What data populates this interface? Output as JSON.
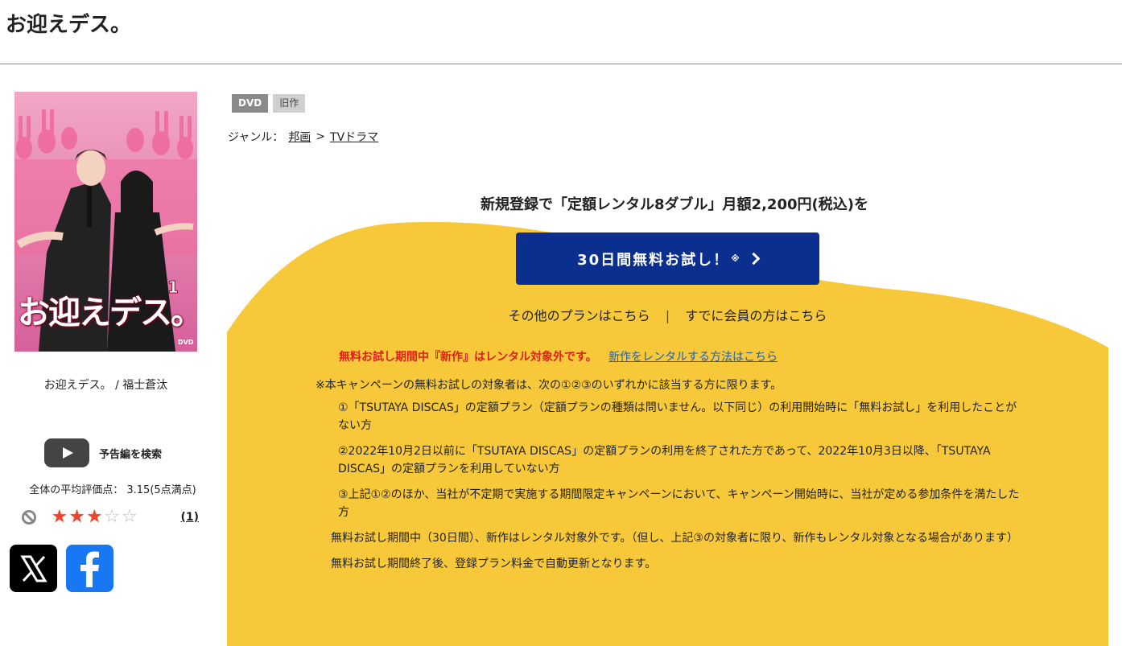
{
  "page": {
    "title": "お迎えデス。"
  },
  "poster": {
    "title_text": "お迎えデス。",
    "volume": "1",
    "dvd_mark": "DVD"
  },
  "work": {
    "caption": "お迎えデス。 / 福士蒼汰"
  },
  "trailer": {
    "label": "予告編を検索"
  },
  "rating": {
    "average_label": "全体の平均評価点： 3.15(5点満点)",
    "stars_value": 3,
    "stars_max": 5,
    "review_count": "(1)"
  },
  "badges": [
    "DVD",
    "旧作"
  ],
  "genre": {
    "label": "ジャンル：",
    "items": [
      "邦画",
      "TVドラマ"
    ],
    "separator": ">"
  },
  "campaign": {
    "headline": "新規登録で「定額レンタル8ダブル」月額2,200円(税込)を",
    "cta_label": "30日間無料お試し！",
    "cta_note": "※",
    "other_plans": "その他のプランはこちら",
    "separator": "|",
    "member_link": "すでに会員の方はこちら",
    "notice_red": "無料お試し期間中『新作』はレンタル対象外です。",
    "notice_link": "新作をレンタルする方法はこちら"
  },
  "terms": {
    "lead": "※本キャンペーンの無料お試しの対象者は、次の①②③のいずれかに該当する方に限ります。",
    "items": [
      "①「TSUTAYA DISCAS」の定額プラン（定額プランの種類は問いません。以下同じ）の利用開始時に「無料お試し」を利用したことがない方",
      "②2022年10月2日以前に「TSUTAYA DISCAS」の定額プランの利用を終了された方であって、2022年10月3日以降、「TSUTAYA DISCAS」の定額プランを利用していない方",
      "③上記①②のほか、当社が不定期で実施する期間限定キャンペーンにおいて、キャンペーン開始時に、当社が定める参加条件を満たした方"
    ],
    "notes": [
      "無料お試し期間中（30日間）、新作はレンタル対象外です。（但し、上記③の対象者に限り、新作もレンタル対象となる場合があります）",
      "無料お試し期間終了後、登録プラン料金で自動更新となります。"
    ]
  },
  "colors": {
    "accent_yellow": "#f7c93a",
    "cta_blue": "#0a2f8f",
    "notice_red": "#e0201a",
    "link_blue": "#1b5fb8"
  }
}
